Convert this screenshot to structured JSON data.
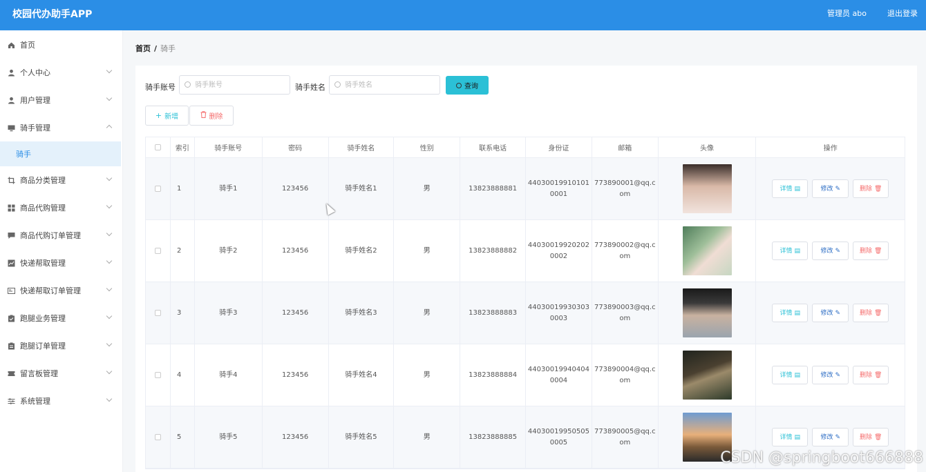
{
  "header": {
    "title": "校园代办助手APP",
    "admin": "管理员 abo",
    "logout": "退出登录"
  },
  "sidebar": {
    "items": [
      {
        "label": "首页",
        "icon": "home-icon"
      },
      {
        "label": "个人中心",
        "icon": "user-icon"
      },
      {
        "label": "用户管理",
        "icon": "user-icon"
      },
      {
        "label": "骑手管理",
        "icon": "monitor-icon",
        "expanded": true
      },
      {
        "label": "骑手",
        "sub": true,
        "active": true
      },
      {
        "label": "商品分类管理",
        "icon": "crop-icon"
      },
      {
        "label": "商品代购管理",
        "icon": "grid-icon"
      },
      {
        "label": "商品代购订单管理",
        "icon": "chat-icon"
      },
      {
        "label": "快递帮取管理",
        "icon": "chart-icon"
      },
      {
        "label": "快递帮取订单管理",
        "icon": "card-icon"
      },
      {
        "label": "跑腿业务管理",
        "icon": "clipboard-icon"
      },
      {
        "label": "跑腿订单管理",
        "icon": "clipboard-icon"
      },
      {
        "label": "留言板管理",
        "icon": "ticket-icon"
      },
      {
        "label": "系统管理",
        "icon": "sliders-icon"
      }
    ]
  },
  "breadcrumb": {
    "home": "首页",
    "sep": "/",
    "current": "骑手"
  },
  "search": {
    "account_label": "骑手账号",
    "account_placeholder": "骑手账号",
    "name_label": "骑手姓名",
    "name_placeholder": "骑手姓名",
    "query_label": "查询"
  },
  "toolbar": {
    "add_label": "新增",
    "delete_label": "删除"
  },
  "table": {
    "columns": [
      "",
      "索引",
      "骑手账号",
      "密码",
      "骑手姓名",
      "性别",
      "联系电话",
      "身份证",
      "邮箱",
      "头像",
      "操作"
    ],
    "rows": [
      {
        "index": "1",
        "account": "骑手1",
        "password": "123456",
        "name": "骑手姓名1",
        "gender": "男",
        "phone": "13823888881",
        "id_card": "440300199101010001",
        "email": "773890001@qq.com"
      },
      {
        "index": "2",
        "account": "骑手2",
        "password": "123456",
        "name": "骑手姓名2",
        "gender": "男",
        "phone": "13823888882",
        "id_card": "440300199202020002",
        "email": "773890002@qq.com"
      },
      {
        "index": "3",
        "account": "骑手3",
        "password": "123456",
        "name": "骑手姓名3",
        "gender": "男",
        "phone": "13823888883",
        "id_card": "440300199303030003",
        "email": "773890003@qq.com"
      },
      {
        "index": "4",
        "account": "骑手4",
        "password": "123456",
        "name": "骑手姓名4",
        "gender": "男",
        "phone": "13823888884",
        "id_card": "440300199404040004",
        "email": "773890004@qq.com"
      },
      {
        "index": "5",
        "account": "骑手5",
        "password": "123456",
        "name": "骑手姓名5",
        "gender": "男",
        "phone": "13823888885",
        "id_card": "440300199505050005",
        "email": "773890005@qq.com"
      }
    ],
    "actions": {
      "detail": "详情",
      "edit": "修改",
      "remove": "删除"
    }
  },
  "watermark": "CSDN @springboot666888",
  "colors": {
    "header": "#2b8ee6",
    "accent": "#2bc0d6",
    "danger": "#f56c6c",
    "active_bg": "#e4f1fb"
  }
}
